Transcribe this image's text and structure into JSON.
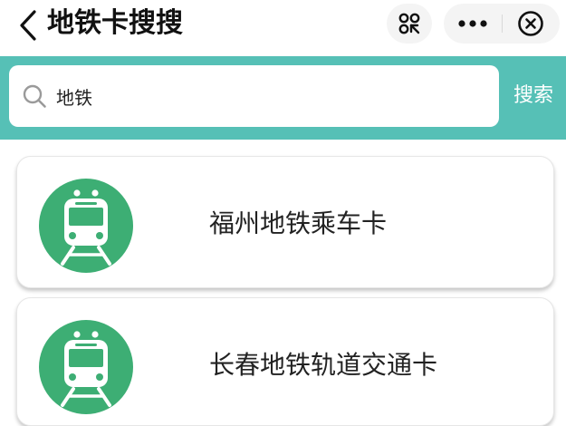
{
  "header": {
    "title": "地铁卡搜搜"
  },
  "search": {
    "value": "地铁",
    "submit_label": "搜索"
  },
  "results": [
    {
      "label": "福州地铁乘车卡",
      "icon": "metro-train-icon"
    },
    {
      "label": "长春地铁轨道交通卡",
      "icon": "metro-train-icon"
    }
  ],
  "colors": {
    "accent": "#56c0b6",
    "icon_green": "#3dae74",
    "text": "#222222"
  }
}
